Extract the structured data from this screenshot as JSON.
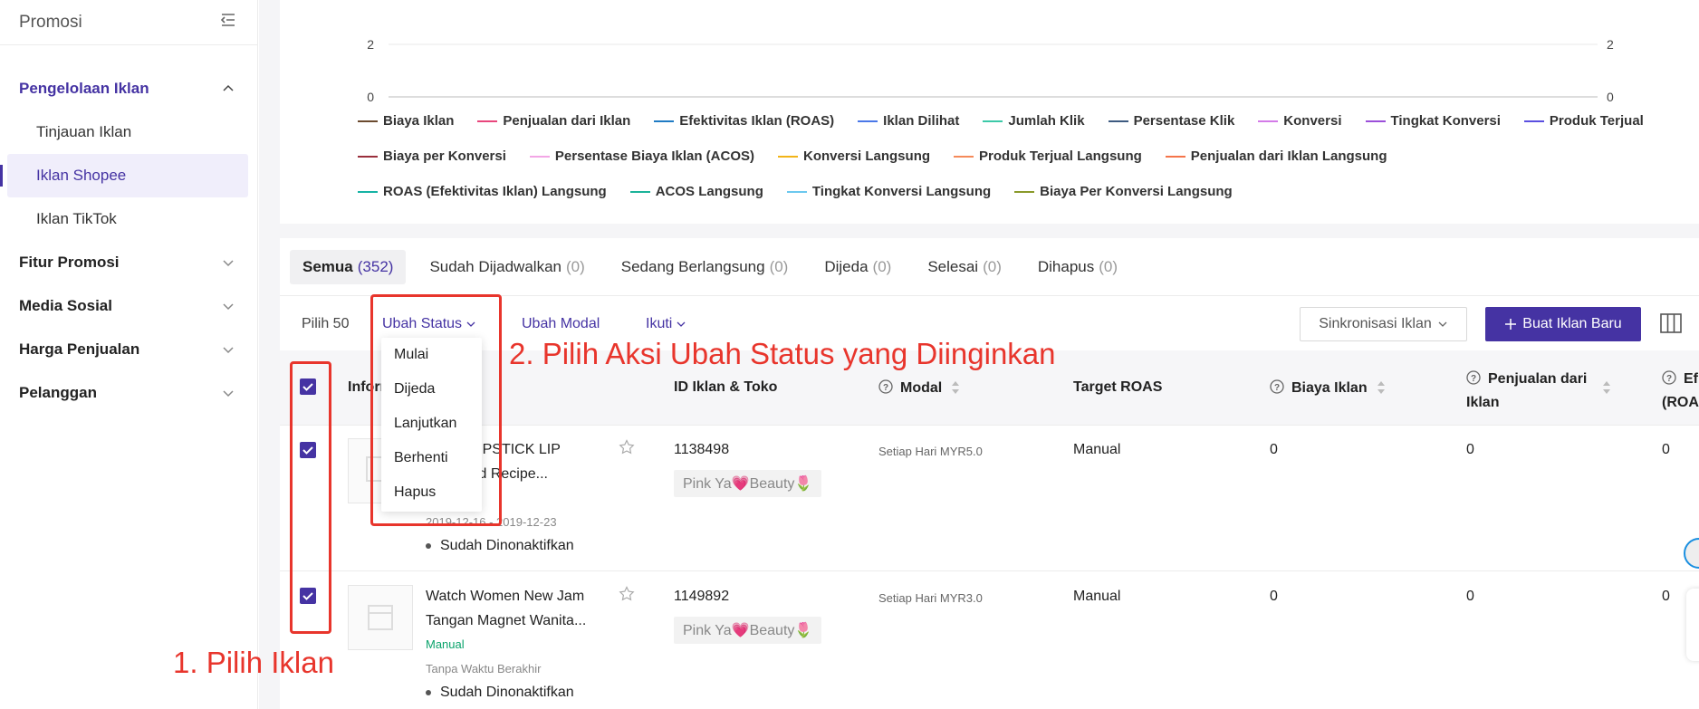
{
  "sidebar": {
    "title": "Promosi",
    "groups": [
      {
        "label": "Pengelolaan Iklan",
        "expanded": true,
        "items": [
          "Tinjauan Iklan",
          "Iklan Shopee",
          "Iklan TikTok"
        ]
      },
      {
        "label": "Fitur Promosi"
      },
      {
        "label": "Media Sosial"
      },
      {
        "label": "Harga Penjualan"
      },
      {
        "label": "Pelanggan"
      }
    ]
  },
  "chart": {
    "tick_top": "2",
    "tick_bottom": "0",
    "tick_top_right": "2",
    "tick_bottom_right": "0"
  },
  "chart_data": {
    "type": "line",
    "ylim": [
      0,
      2
    ],
    "yticks": [
      0,
      2
    ],
    "grid": true,
    "legend_position": "bottom",
    "series": [
      {
        "name": "Biaya Iklan",
        "color": "#6b4a2f"
      },
      {
        "name": "Penjualan dari Iklan",
        "color": "#e8467c"
      },
      {
        "name": "Efektivitas Iklan (ROAS)",
        "color": "#1f7bc4"
      },
      {
        "name": "Iklan Dilihat",
        "color": "#4a78e8"
      },
      {
        "name": "Jumlah Klik",
        "color": "#3cc9a8"
      },
      {
        "name": "Persentase Klik",
        "color": "#3d5a80"
      },
      {
        "name": "Konversi",
        "color": "#d37be8"
      },
      {
        "name": "Tingkat Konversi",
        "color": "#9b4fd9"
      },
      {
        "name": "Produk Terjual",
        "color": "#5a4fe0"
      },
      {
        "name": "Biaya per Konversi",
        "color": "#9a2f3c"
      },
      {
        "name": "Persentase Biaya Iklan (ACOS)",
        "color": "#f3a6e6"
      },
      {
        "name": "Konversi Langsung",
        "color": "#f2b418"
      },
      {
        "name": "Produk Terjual Langsung",
        "color": "#f58a5a"
      },
      {
        "name": "Penjualan dari Iklan Langsung",
        "color": "#f5744a"
      },
      {
        "name": "ROAS (Efektivitas Iklan) Langsung",
        "color": "#16b3a5"
      },
      {
        "name": "ACOS Langsung",
        "color": "#1cb39a"
      },
      {
        "name": "Tingkat Konversi Langsung",
        "color": "#6cc8ef"
      },
      {
        "name": "Biaya Per Konversi Langsung",
        "color": "#8a9a2a"
      }
    ]
  },
  "tabs": [
    {
      "label": "Semua",
      "count": "(352)"
    },
    {
      "label": "Sudah Dijadwalkan",
      "count": "(0)"
    },
    {
      "label": "Sedang Berlangsung",
      "count": "(0)"
    },
    {
      "label": "Dijeda",
      "count": "(0)"
    },
    {
      "label": "Selesai",
      "count": "(0)"
    },
    {
      "label": "Dihapus",
      "count": "(0)"
    }
  ],
  "toolbar": {
    "select_count": "Pilih 50",
    "change_status": "Ubah Status",
    "change_budget": "Ubah Modal",
    "follow": "Ikuti",
    "sync": "Sinkronisasi Iklan",
    "new_ad": "Buat Iklan Baru"
  },
  "status_menu": [
    "Mulai",
    "Dijeda",
    "Lanjutkan",
    "Berhenti",
    "Hapus"
  ],
  "columns": {
    "info": "Inform",
    "id_shop": "ID Iklan & Toko",
    "budget": "Modal",
    "target_roas": "Target ROAS",
    "ad_cost": "Biaya Iklan",
    "sales_line1": "Penjualan dari",
    "sales_line2": "Iklan",
    "eff_line1": "Ef",
    "eff_line2": "(ROAS"
  },
  "rows": [
    {
      "name_line1": "VET LIPSTICK LIP",
      "name_line2": "e Mood Recipe...",
      "date": "2019-12-16 - 2019-12-23",
      "status": "Sudah Dinonaktifkan",
      "id": "1138498",
      "shop": "Pink Ya💗Beauty🌷",
      "budget": "Setiap Hari MYR5.0",
      "target_roas": "Manual",
      "ad_cost": "0",
      "sales": "0",
      "roas": "0"
    },
    {
      "name_line1": "Watch Women New Jam",
      "name_line2": "Tangan Magnet Wanita...",
      "tag": "Manual",
      "date": "Tanpa Waktu Berakhir",
      "status": "Sudah Dinonaktifkan",
      "id": "1149892",
      "shop": "Pink Ya💗Beauty🌷",
      "budget": "Setiap Hari MYR3.0",
      "target_roas": "Manual",
      "ad_cost": "0",
      "sales": "0",
      "roas": "0"
    }
  ],
  "annotations": {
    "step1": "1. Pilih Iklan",
    "step2": "2. Pilih Aksi Ubah Status yang Diinginkan"
  },
  "colors": {
    "accent": "#4533a3",
    "annotation": "#e8352c",
    "tag_green": "#0aa36b"
  }
}
